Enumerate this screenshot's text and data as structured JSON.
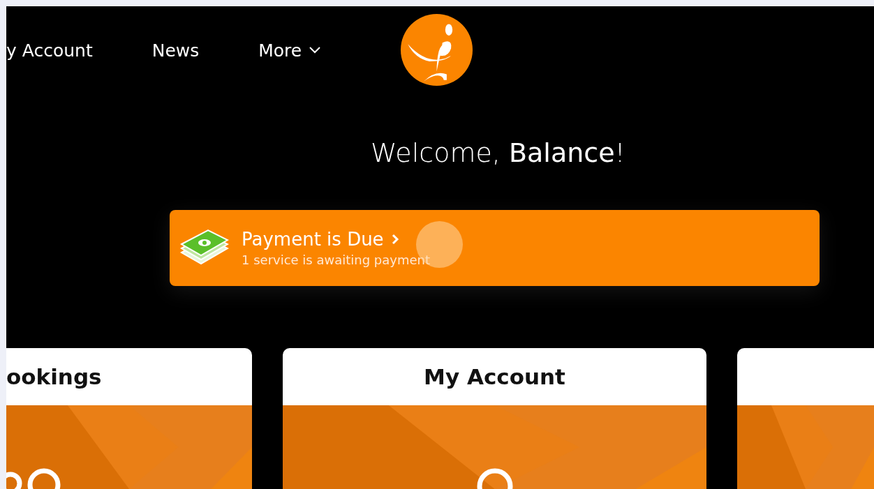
{
  "nav": {
    "items": [
      {
        "label": "y Account",
        "dropdown": false
      },
      {
        "label": "News",
        "dropdown": false
      },
      {
        "label": "More",
        "dropdown": true
      }
    ]
  },
  "welcome": {
    "text": "Welcome, **Balance**!"
  },
  "banner": {
    "title": "Payment is Due",
    "subtitle": "1 service is awaiting payment"
  },
  "cards": [
    {
      "title": "ookings",
      "kind": "people"
    },
    {
      "title": "My Account",
      "kind": "person"
    },
    {
      "kind": "plain"
    }
  ]
}
